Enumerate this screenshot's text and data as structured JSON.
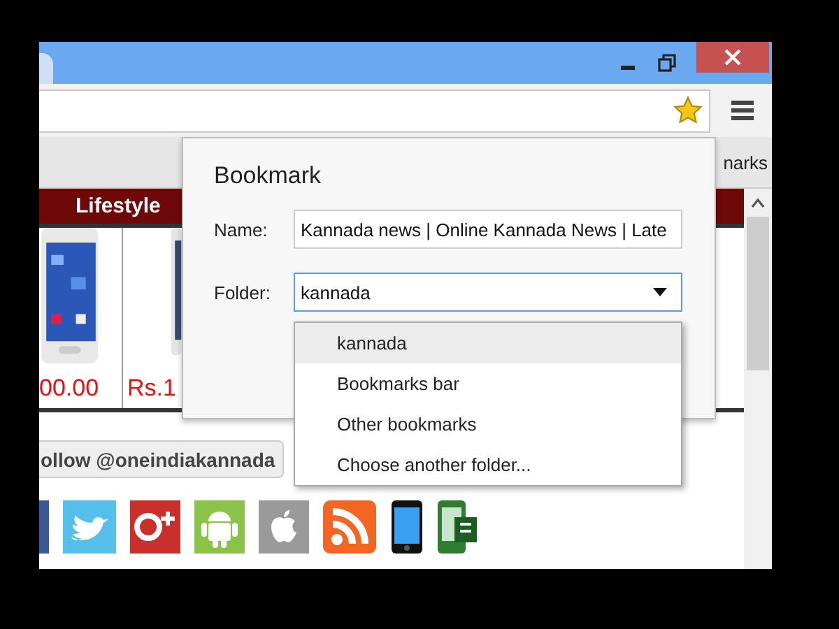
{
  "address_bar": {
    "bookmarked": true
  },
  "bookmarks_bar": {
    "item": "narks"
  },
  "nav": {
    "label": "Lifestyle"
  },
  "products": [
    {
      "price": "00.00"
    },
    {
      "price": "Rs.1"
    }
  ],
  "follow_button": {
    "label": "ollow @oneindiakannada"
  },
  "dialog": {
    "title": "Bookmark",
    "name_label": "Name:",
    "name_value": "Kannada news | Online Kannada News | Late",
    "folder_label": "Folder:",
    "folder_value": "kannada"
  },
  "folder_options": [
    {
      "label": "kannada",
      "selected": true
    },
    {
      "label": "Bookmarks bar",
      "selected": false
    },
    {
      "label": "Other bookmarks",
      "selected": false
    },
    {
      "label": "Choose another folder...",
      "selected": false
    }
  ]
}
